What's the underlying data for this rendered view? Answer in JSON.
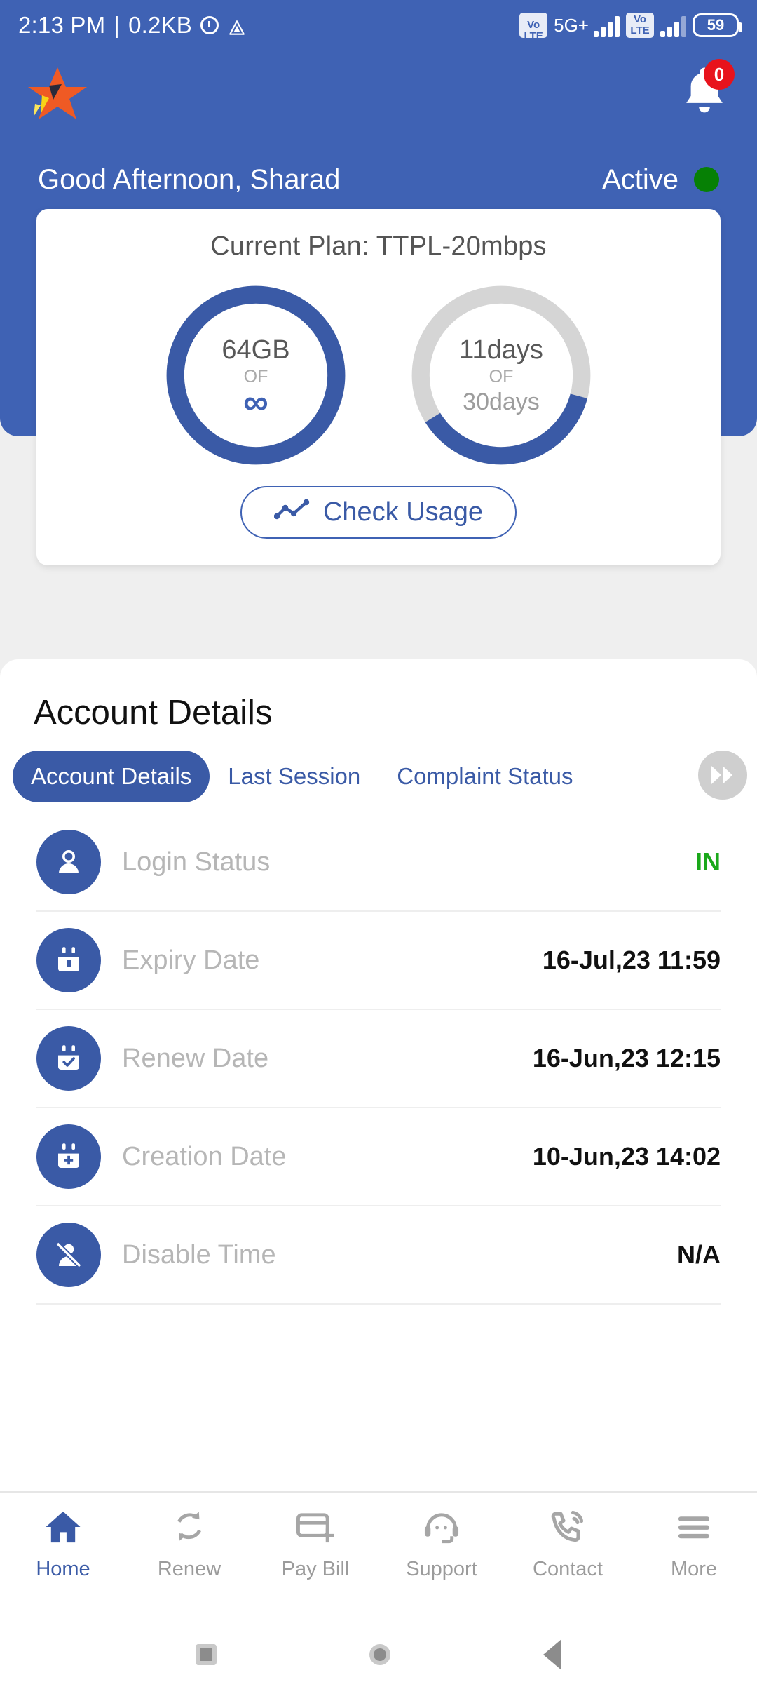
{
  "statusbar": {
    "time": "2:13 PM",
    "separator": "|",
    "data_usage": "0.2KB",
    "alarm_icon": "alarm-icon",
    "triangle_icon": "drive-icon",
    "sim1_volte": "VoLTE",
    "network_type": "5G+",
    "sim2_volte": "VoLTE",
    "battery_level": "59"
  },
  "appbar": {
    "logo_icon": "star-logo",
    "bell_icon": "notification-bell-icon",
    "notification_count": "0"
  },
  "hero": {
    "greeting": "Good Afternoon, Sharad",
    "status_text": "Active",
    "status_color": "#068005"
  },
  "plan_card": {
    "title": "Current Plan: TTPL-20mbps",
    "data_donut": {
      "value": "64GB",
      "of": "OF",
      "total": "∞",
      "percent": 100,
      "color": "#3a5aa6",
      "track": "#d5d5d5"
    },
    "days_donut": {
      "value": "11days",
      "of": "OF",
      "total": "30days",
      "percent": 37,
      "color": "#3a5aa6",
      "track": "#d5d5d5"
    },
    "usage_button": {
      "label": "Check Usage",
      "icon": "line-chart-icon"
    }
  },
  "account": {
    "title": "Account Details",
    "tabs": [
      {
        "label": "Account Details",
        "active": true
      },
      {
        "label": "Last Session",
        "active": false
      },
      {
        "label": "Complaint Status",
        "active": false
      }
    ],
    "forward_icon": "fast-forward-icon",
    "rows": [
      {
        "icon": "user-icon",
        "label": "Login Status",
        "value": "IN",
        "value_color": "green"
      },
      {
        "icon": "calendar-icon",
        "label": "Expiry Date",
        "value": "16-Jul,23 11:59",
        "value_color": "dark"
      },
      {
        "icon": "calendar-check-icon",
        "label": "Renew Date",
        "value": "16-Jun,23 12:15",
        "value_color": "dark"
      },
      {
        "icon": "calendar-plus-icon",
        "label": "Creation Date",
        "value": "10-Jun,23 14:02",
        "value_color": "dark"
      },
      {
        "icon": "user-slash-icon",
        "label": "Disable Time",
        "value": "N/A",
        "value_color": "dark"
      }
    ]
  },
  "bottom_nav": [
    {
      "label": "Home",
      "icon": "home-icon",
      "active": true
    },
    {
      "label": "Renew",
      "icon": "refresh-icon",
      "active": false
    },
    {
      "label": "Pay Bill",
      "icon": "card-plus-icon",
      "active": false
    },
    {
      "label": "Support",
      "icon": "headset-icon",
      "active": false
    },
    {
      "label": "Contact",
      "icon": "phone-icon",
      "active": false
    },
    {
      "label": "More",
      "icon": "hamburger-icon",
      "active": false
    }
  ],
  "system_nav": {
    "recents_icon": "recents-square-icon",
    "home_icon": "home-circle-icon",
    "back_icon": "back-triangle-icon"
  },
  "theme": {
    "primary": "#3f62b4",
    "primary_dark": "#3a5aa6",
    "background": "#efefef",
    "badge_red": "#e8131c"
  }
}
